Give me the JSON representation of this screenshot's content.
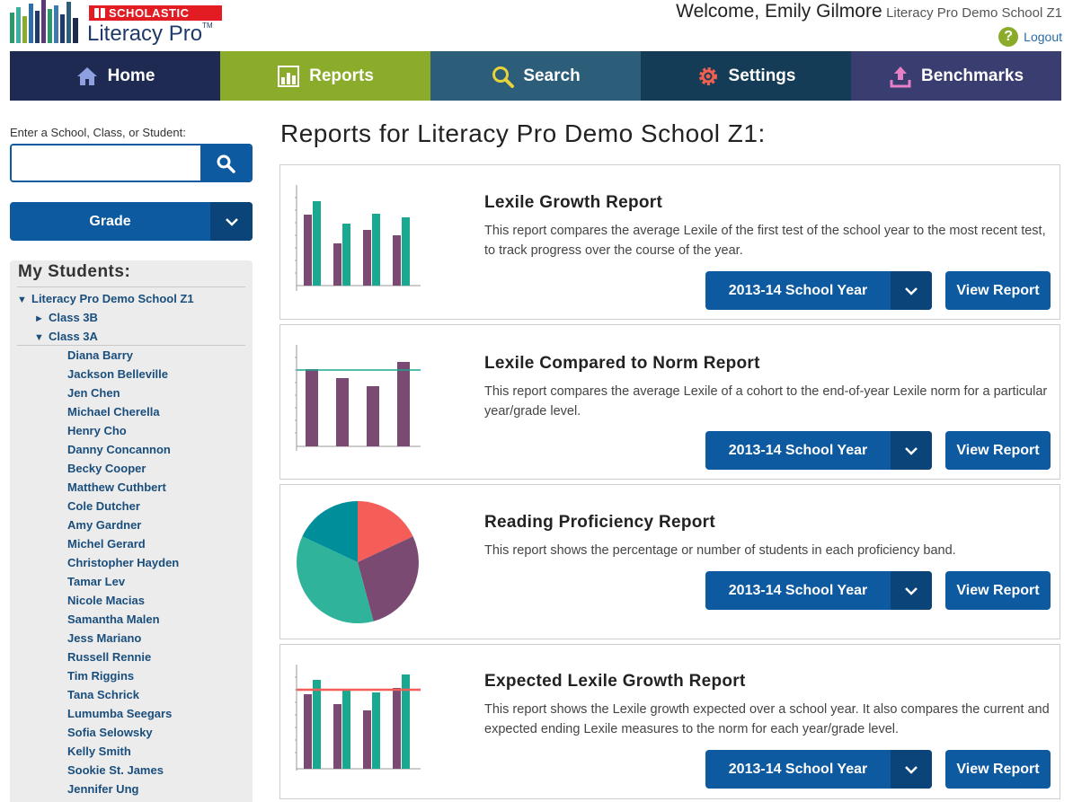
{
  "brand": {
    "badge": "SCHOLASTIC",
    "product": "Literacy Pro",
    "tm": "TM"
  },
  "header": {
    "welcome": "Welcome, Emily Gilmore",
    "school": "Literacy Pro Demo School Z1",
    "help": "?",
    "logout": "Logout"
  },
  "nav": {
    "home": "Home",
    "reports": "Reports",
    "search": "Search",
    "settings": "Settings",
    "benchmarks": "Benchmarks"
  },
  "colors": {
    "nav_home": "#1f2a52",
    "nav_reports": "#8aac2a",
    "nav_search": "#2d5e79",
    "nav_settings": "#143c56",
    "nav_benchmarks": "#3a3d70",
    "button_blue": "#0d5aa0",
    "purple": "#7b4a73",
    "teal": "#1aa890",
    "coral": "#f45d58"
  },
  "sidebar": {
    "search_label": "Enter a School, Class, or Student:",
    "search_value": "",
    "grade_label": "Grade",
    "students_title": "My Students:",
    "school": "Literacy Pro Demo School Z1",
    "class_closed": "Class 3B",
    "class_open": "Class 3A",
    "students": [
      "Diana Barry",
      "Jackson Belleville",
      "Jen Chen",
      "Michael Cherella",
      "Henry Cho",
      "Danny Concannon",
      "Becky Cooper",
      "Matthew Cuthbert",
      "Cole Dutcher",
      "Amy Gardner",
      "Michel Gerard",
      "Christopher Hayden",
      "Tamar Lev",
      "Nicole Macias",
      "Samantha Malen",
      "Jess Mariano",
      "Russell Rennie",
      "Tim Riggins",
      "Tana Schrick",
      "Lumumba Seegars",
      "Sofia Selowsky",
      "Kelly Smith",
      "Sookie St. James",
      "Jennifer Ung"
    ]
  },
  "main": {
    "page_title": "Reports for Literacy Pro Demo School Z1:",
    "reports": [
      {
        "title": "Lexile Growth Report",
        "description": "This report compares the average Lexile of the first test of the school year to the most recent test, to track progress over the course of the year.",
        "year": "2013-14 School Year",
        "view": "View Report"
      },
      {
        "title": "Lexile Compared to Norm Report",
        "description": "This report compares the average Lexile of a cohort to the end-of-year Lexile norm for a particular year/grade level.",
        "year": "2013-14 School Year",
        "view": "View Report"
      },
      {
        "title": "Reading Proficiency Report",
        "description": "This report shows the percentage or number of students in each proficiency band.",
        "year": "2013-14 School Year",
        "view": "View Report"
      },
      {
        "title": "Expected Lexile Growth Report",
        "description": "This report shows the Lexile growth expected over a school year. It also compares the current and expected ending Lexile measures to the norm for each year/grade level.",
        "year": "2013-14 School Year",
        "view": "View Report"
      }
    ]
  }
}
